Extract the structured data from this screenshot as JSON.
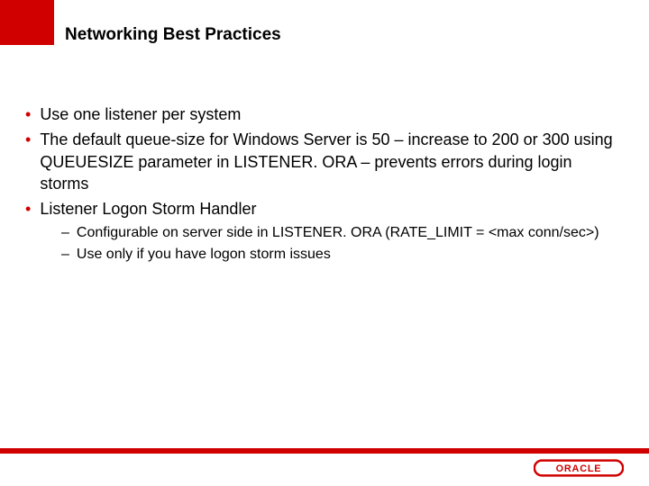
{
  "title": "Networking Best Practices",
  "bullets": {
    "b0": "Use one listener per system",
    "b1": "The default queue-size for Windows Server is 50  – increase to 200 or 300 using QUEUESIZE parameter in LISTENER. ORA – prevents errors during login storms",
    "b2": "Listener Logon Storm Handler"
  },
  "subs": {
    "s0": "Configurable on server side in LISTENER. ORA (RATE_LIMIT = <max conn/sec>)",
    "s1": "Use only if you have logon storm issues"
  },
  "logo_text": "ORACLE"
}
